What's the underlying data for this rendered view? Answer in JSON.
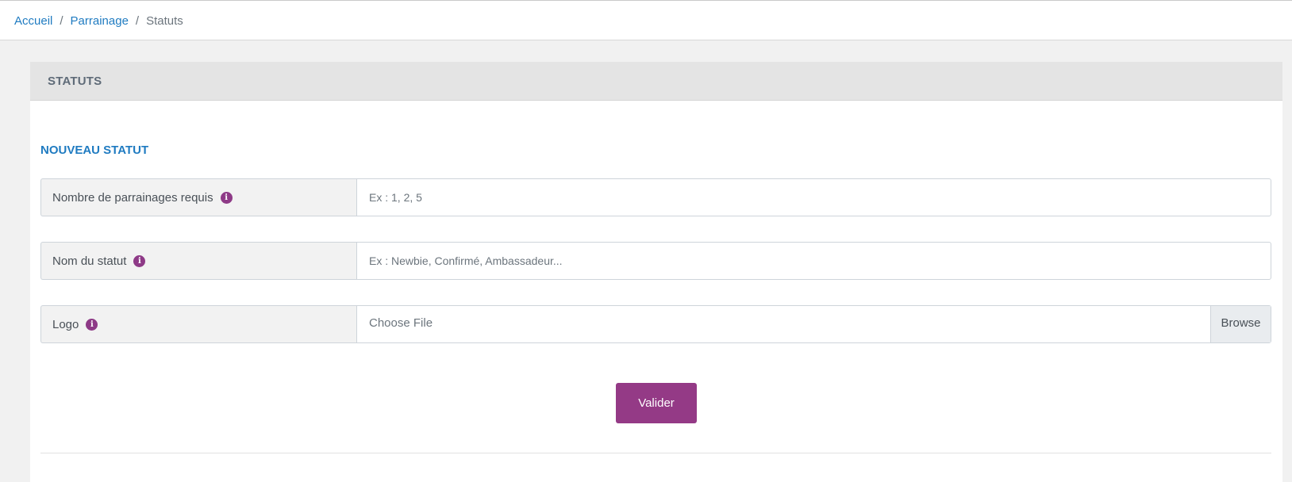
{
  "breadcrumb": {
    "home": "Accueil",
    "parent": "Parrainage",
    "current": "Statuts",
    "separator": "/"
  },
  "card": {
    "title": "STATUTS",
    "section_title": "NOUVEAU STATUT"
  },
  "form": {
    "fields": [
      {
        "label": "Nombre de parrainages requis",
        "placeholder": "Ex : 1, 2, 5",
        "value": ""
      },
      {
        "label": "Nom du statut",
        "placeholder": "Ex : Newbie, Confirmé, Ambassadeur...",
        "value": ""
      },
      {
        "label": "Logo",
        "file_text": "Choose File",
        "browse_label": "Browse"
      }
    ],
    "submit_label": "Valider"
  },
  "icons": {
    "info": "info-icon",
    "info_glyph": "i"
  },
  "colors": {
    "link": "#1f7bc1",
    "accent": "#943a86",
    "header_bg": "#e4e4e4",
    "page_bg": "#f1f1f1"
  }
}
